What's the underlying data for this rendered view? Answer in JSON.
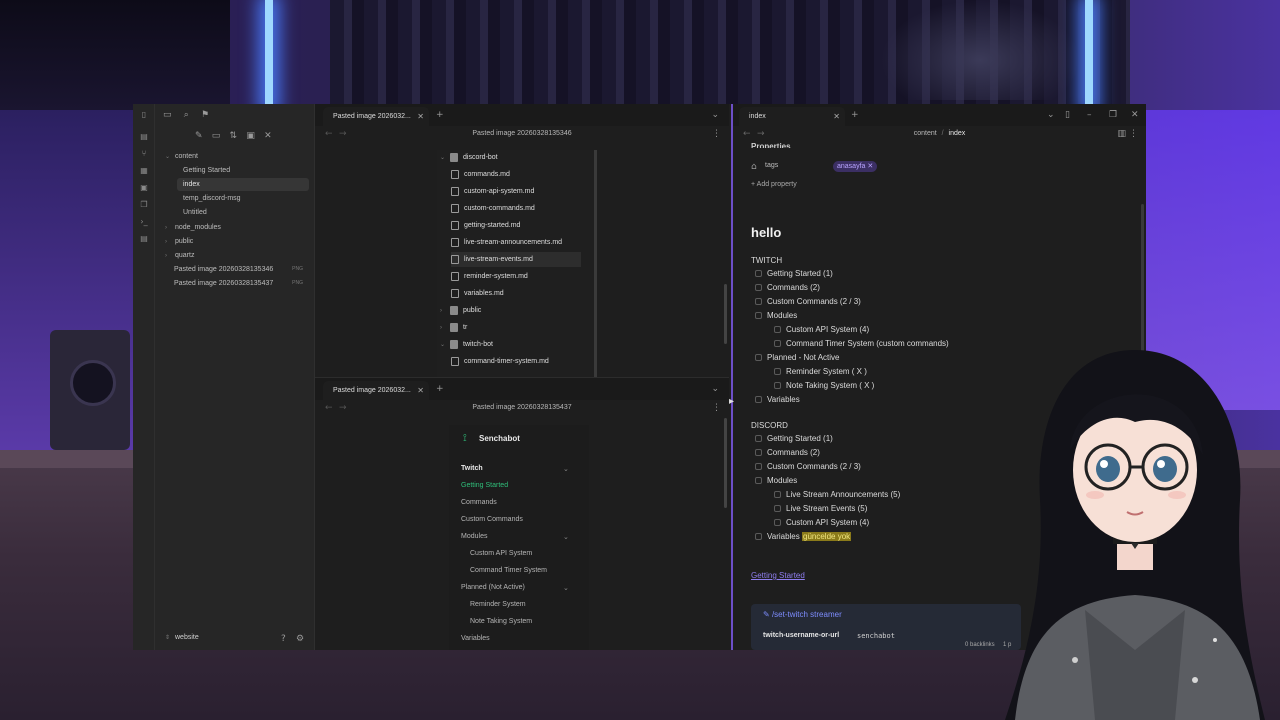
{
  "explorer": {
    "items": [
      {
        "label": "content"
      },
      {
        "label": "Getting Started"
      },
      {
        "label": "index"
      },
      {
        "label": "temp_discord-msg"
      },
      {
        "label": "Untitled"
      },
      {
        "label": "node_modules"
      },
      {
        "label": "public"
      },
      {
        "label": "quartz"
      },
      {
        "label": "Pasted image 20260328135346",
        "badge": "PNG"
      },
      {
        "label": "Pasted image 20260328135437",
        "badge": "PNG"
      }
    ],
    "vault_name": "website"
  },
  "pane_top": {
    "tab_label": "Pasted image 2026032...",
    "title": "Pasted image 20260328135346",
    "files": [
      "discord-bot",
      "commands.md",
      "custom-api-system.md",
      "custom-commands.md",
      "getting-started.md",
      "live-stream-announcements.md",
      "live-stream-events.md",
      "reminder-system.md",
      "variables.md",
      "public",
      "tr",
      "twitch-bot",
      "command-timer-system.md"
    ]
  },
  "pane_bottom": {
    "tab_label": "Pasted image 2026032...",
    "title": "Pasted image 20260328135437",
    "brand": "Senchabot",
    "nav": [
      "Twitch",
      "Getting Started",
      "Commands",
      "Custom Commands",
      "Modules",
      "Custom API System",
      "Command Timer System",
      "Planned (Not Active)",
      "Reminder System",
      "Note Taking System",
      "Variables"
    ]
  },
  "note": {
    "tab_label": "index",
    "breadcrumb_a": "content",
    "breadcrumb_sep": "/",
    "breadcrumb_b": "index",
    "properties_label": "Properties",
    "tags_label": "tags",
    "tag_value": "anasayfa",
    "add_property": "Add property",
    "heading": "hello",
    "twitch_header": "TWITCH",
    "twitch_items": [
      "Getting Started (1)",
      "Commands (2)",
      "Custom Commands (2 / 3)",
      "Modules",
      "Custom API System (4)",
      "Command Timer System (custom commands)",
      "Planned - Not Active",
      "Reminder System ( X )",
      "Note Taking System ( X )",
      "Variables"
    ],
    "discord_header": "DISCORD",
    "discord_items": [
      "Getting Started (1)",
      "Commands (2)",
      "Custom Commands (2 / 3)",
      "Modules",
      "Live Stream Announcements (5)",
      "Live Stream Events (5)",
      "Custom API System (4)",
      "Variables"
    ],
    "variables_highlight": "güncelde yok",
    "getting_started_link": "Getting Started",
    "command_link": "/set-twitch streamer",
    "param_name": "twitch-username-or-url",
    "param_value": "senchabot",
    "backlinks": "0 backlinks",
    "page_count": "1 p"
  },
  "colors": {
    "accent": "#6d4fc8",
    "green": "#2fbf7a",
    "highlight": "#8a7a1a"
  }
}
